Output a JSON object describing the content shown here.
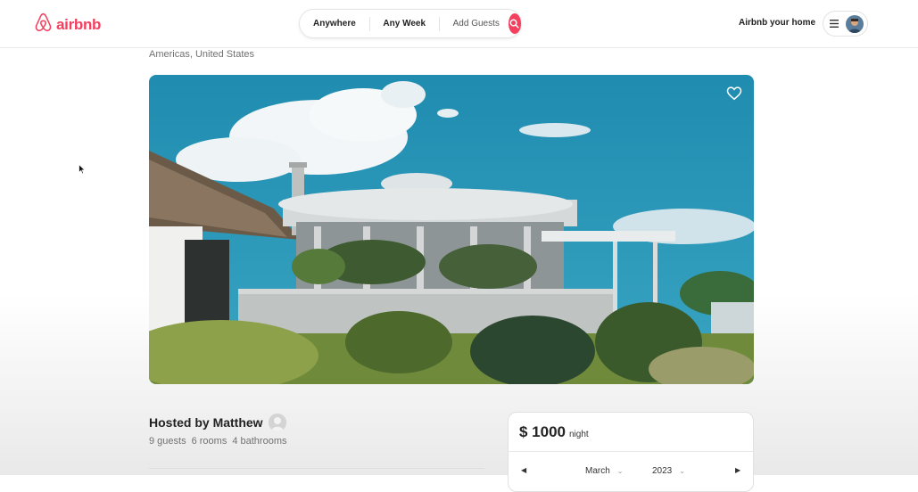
{
  "brand": {
    "name": "airbnb",
    "color": "#f43f5e"
  },
  "search": {
    "location_label": "Anywhere",
    "date_label": "Any Week",
    "guests_label": "Add Guests",
    "button_icon": "search-icon"
  },
  "user_nav": {
    "host_link": "Airbnb your home",
    "menu_icon": "hamburger-icon",
    "avatar_icon": "avatar"
  },
  "listing": {
    "location": "Americas, United States",
    "favorite_icon": "heart-icon",
    "host_label": "Hosted by Matthew",
    "guests": "9 guests",
    "rooms": "6 rooms",
    "bathrooms": "4 bathrooms"
  },
  "booking": {
    "price": "$ 1000",
    "per": "night",
    "calendar": {
      "month": "March",
      "year": "2023",
      "prev_icon": "caret-left-icon",
      "next_icon": "caret-right-icon"
    }
  }
}
